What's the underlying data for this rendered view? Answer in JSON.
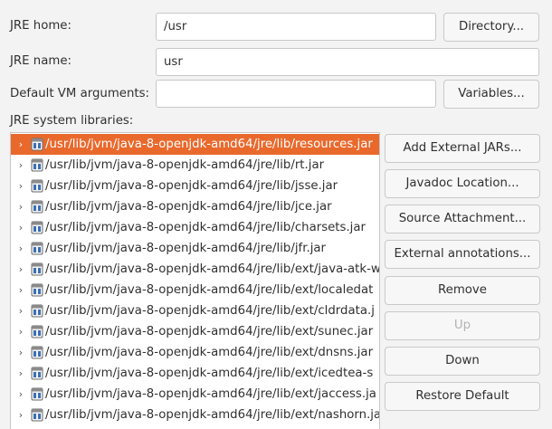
{
  "form": {
    "jre_home_label": "JRE home:",
    "jre_home_value": "/usr",
    "jre_name_label": "JRE name:",
    "jre_name_value": "usr",
    "vm_args_label": "Default VM arguments:",
    "vm_args_value": "",
    "libraries_label": "JRE system libraries:"
  },
  "buttons": {
    "directory": "Directory...",
    "variables": "Variables...",
    "add_external_jars": "Add External JARs...",
    "javadoc_location": "Javadoc Location...",
    "source_attachment": "Source Attachment...",
    "external_annotations": "External annotations...",
    "remove": "Remove",
    "up": "Up",
    "down": "Down",
    "restore_default": "Restore Default"
  },
  "libraries": [
    {
      "path": "/usr/lib/jvm/java-8-openjdk-amd64/jre/lib/resources.jar",
      "selected": true
    },
    {
      "path": "/usr/lib/jvm/java-8-openjdk-amd64/jre/lib/rt.jar",
      "selected": false
    },
    {
      "path": "/usr/lib/jvm/java-8-openjdk-amd64/jre/lib/jsse.jar",
      "selected": false
    },
    {
      "path": "/usr/lib/jvm/java-8-openjdk-amd64/jre/lib/jce.jar",
      "selected": false
    },
    {
      "path": "/usr/lib/jvm/java-8-openjdk-amd64/jre/lib/charsets.jar",
      "selected": false
    },
    {
      "path": "/usr/lib/jvm/java-8-openjdk-amd64/jre/lib/jfr.jar",
      "selected": false
    },
    {
      "path": "/usr/lib/jvm/java-8-openjdk-amd64/jre/lib/ext/java-atk-w",
      "selected": false
    },
    {
      "path": "/usr/lib/jvm/java-8-openjdk-amd64/jre/lib/ext/localedat",
      "selected": false
    },
    {
      "path": "/usr/lib/jvm/java-8-openjdk-amd64/jre/lib/ext/cldrdata.j",
      "selected": false
    },
    {
      "path": "/usr/lib/jvm/java-8-openjdk-amd64/jre/lib/ext/sunec.jar",
      "selected": false
    },
    {
      "path": "/usr/lib/jvm/java-8-openjdk-amd64/jre/lib/ext/dnsns.jar",
      "selected": false
    },
    {
      "path": "/usr/lib/jvm/java-8-openjdk-amd64/jre/lib/ext/icedtea-s",
      "selected": false
    },
    {
      "path": "/usr/lib/jvm/java-8-openjdk-amd64/jre/lib/ext/jaccess.ja",
      "selected": false
    },
    {
      "path": "/usr/lib/jvm/java-8-openjdk-amd64/jre/lib/ext/nashorn.ja",
      "selected": false
    }
  ],
  "icons": {
    "expand": "chevron-right-icon",
    "library": "jar-file-icon"
  },
  "colors": {
    "selection": "#e9692c",
    "background": "#f3f3f3",
    "field_border": "#c8c8c8",
    "disabled_text": "#b3b3b3"
  }
}
